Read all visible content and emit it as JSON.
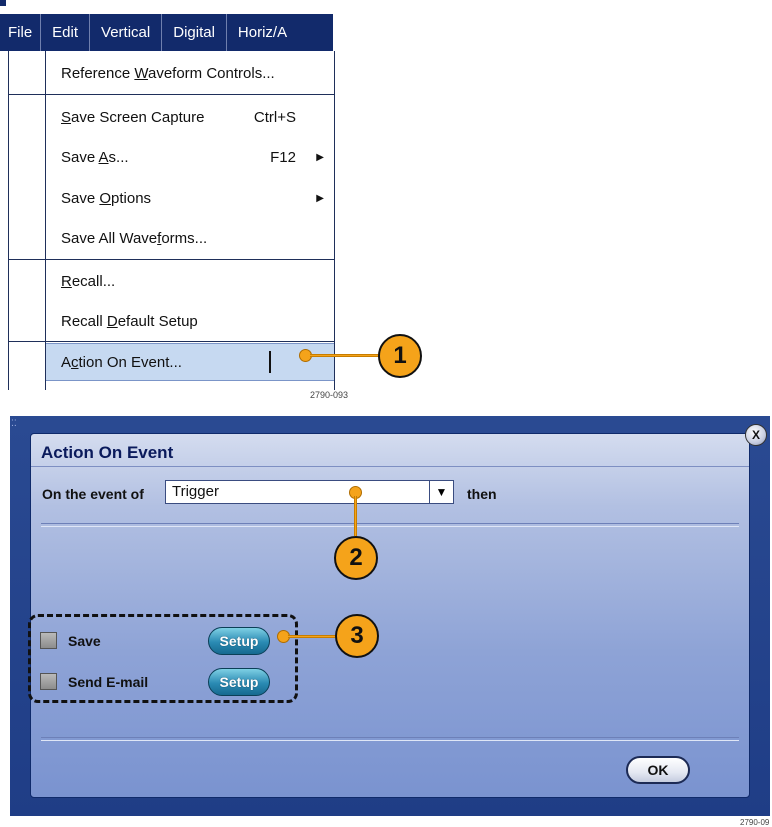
{
  "menubar": {
    "items": [
      "File",
      "Edit",
      "Vertical",
      "Digital",
      "Horiz/A"
    ]
  },
  "file_menu": {
    "items": [
      {
        "pre": "Reference ",
        "u": "W",
        "post": "aveform Controls...",
        "shortcut": "",
        "submenu": false
      },
      {
        "pre": "",
        "u": "S",
        "post": "ave Screen Capture",
        "shortcut": "Ctrl+S",
        "submenu": false
      },
      {
        "pre": "Save ",
        "u": "A",
        "post": "s...",
        "shortcut": "F12",
        "submenu": true
      },
      {
        "pre": "Save ",
        "u": "O",
        "post": "ptions",
        "shortcut": "",
        "submenu": true
      },
      {
        "pre": "Save All Wave",
        "u": "f",
        "post": "orms...",
        "shortcut": "",
        "submenu": false
      },
      {
        "pre": "",
        "u": "R",
        "post": "ecall...",
        "shortcut": "",
        "submenu": false
      },
      {
        "pre": "Recall ",
        "u": "D",
        "post": "efault Setup",
        "shortcut": "",
        "submenu": false
      },
      {
        "pre": "A",
        "u": "c",
        "post": "tion On Event...",
        "shortcut": "",
        "submenu": false
      }
    ],
    "highlighted_index": 7,
    "highlight_color": "#c6d9f1"
  },
  "figure_refs": {
    "top": "2790-093",
    "bottom": "2790-09"
  },
  "callouts": {
    "one": "1",
    "two": "2",
    "three": "3",
    "color": "#f5a31a"
  },
  "dialog": {
    "title": "Action On Event",
    "event_label": "On the event of",
    "event_value": "Trigger",
    "then_label": "then",
    "actions": [
      {
        "label": "Save",
        "checked": false,
        "button": "Setup"
      },
      {
        "label": "Send E-mail",
        "checked": false,
        "button": "Setup"
      }
    ],
    "ok_label": "OK",
    "close_label": "X"
  },
  "icons": {
    "dropdown": "▼",
    "submenu": "▶",
    "grip": "⁚⁚"
  }
}
